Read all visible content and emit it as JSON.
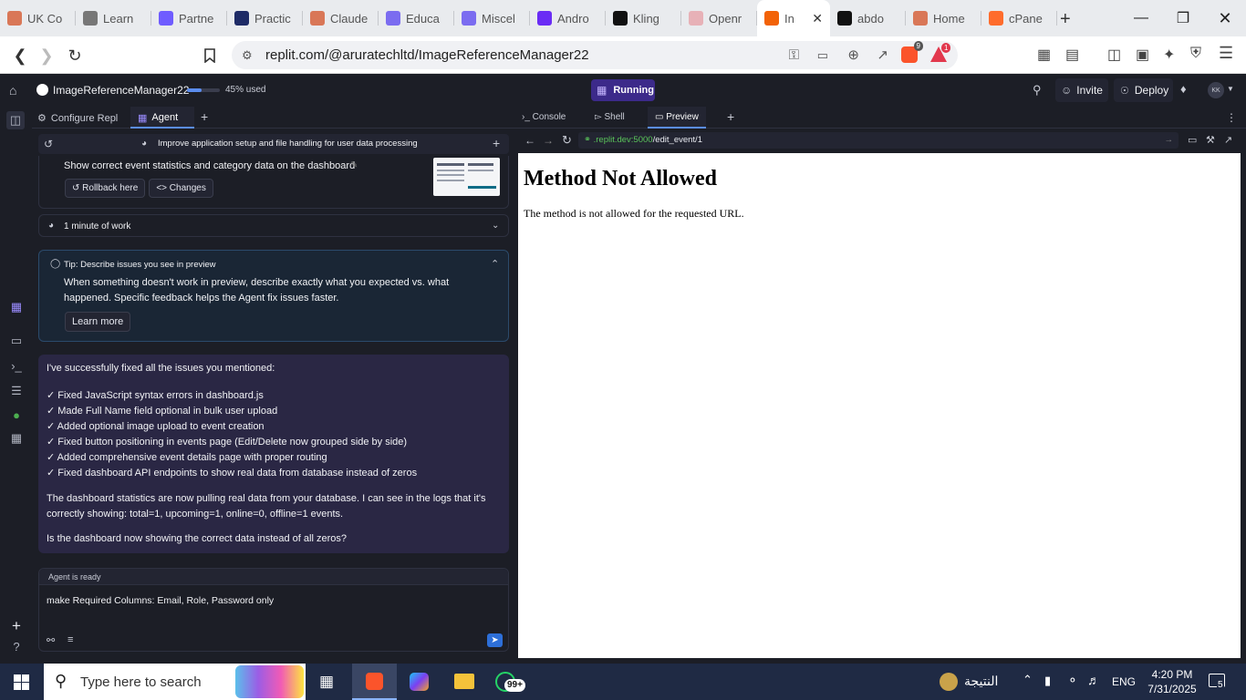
{
  "browser": {
    "tabs": [
      {
        "label": "UK Co",
        "icon": "claude-icon",
        "color": "#d97757"
      },
      {
        "label": "Learn",
        "icon": "tools-icon",
        "color": "#777777"
      },
      {
        "label": "Partne",
        "icon": "purple-app-icon",
        "color": "#6f5cff"
      },
      {
        "label": "Practic",
        "icon": "flag-icon",
        "color": "#1e2b66"
      },
      {
        "label": "Claude",
        "icon": "claude-icon",
        "color": "#d97757"
      },
      {
        "label": "Educa",
        "icon": "play-icon",
        "color": "#7b6cf0"
      },
      {
        "label": "Miscel",
        "icon": "play-icon",
        "color": "#7b6cf0"
      },
      {
        "label": "Andro",
        "icon": "d-icon",
        "color": "#6a2cf5"
      },
      {
        "label": "Kling",
        "icon": "kling-icon",
        "color": "#111111"
      },
      {
        "label": "Openr",
        "icon": "openr-icon",
        "color": "#e7b1b7"
      },
      {
        "label": "In",
        "icon": "replit-icon",
        "color": "#f26207",
        "active": true
      },
      {
        "label": "abdo",
        "icon": "github-icon",
        "color": "#111111"
      },
      {
        "label": "Home",
        "icon": "claude-icon",
        "color": "#d97757"
      },
      {
        "label": "cPane",
        "icon": "cpanel-icon",
        "color": "#ff6c2c"
      }
    ],
    "url": "replit.com/@aruratechltd/ImageReferenceManager22",
    "brave_badge": "9",
    "alert_badge": "1"
  },
  "replit": {
    "project_name": "ImageReferenceManager22",
    "usage_text": "45% used",
    "usage_fraction": 0.45,
    "run_status": "Running",
    "invite_label": "Invite",
    "deploy_label": "Deploy",
    "avatar_initials": "KK",
    "left_tabs": [
      "Configure Repl",
      "Agent"
    ],
    "right_tabs": [
      "Console",
      "Shell",
      "Preview"
    ]
  },
  "agent": {
    "thread_title": "Improve application setup and file handling for user data processing",
    "checkpoint_text": "Show correct event statistics and category data on the dashboard",
    "rollback_label": "Rollback here",
    "changes_label": "Changes",
    "work_duration": "1 minute of work",
    "tip": {
      "title": "Tip: Describe issues you see in preview",
      "body": "When something doesn't work in preview, describe exactly what you expected vs. what happened. Specific feedback helps the Agent fix issues faster.",
      "button": "Learn more"
    },
    "message": {
      "intro": "I've successfully fixed all the issues you mentioned:",
      "items": [
        "✓ Fixed JavaScript syntax errors in dashboard.js",
        "✓ Made Full Name field optional in bulk user upload",
        "✓ Added optional image upload to event creation",
        "✓ Fixed button positioning in events page (Edit/Delete now grouped side by side)",
        "✓ Added comprehensive event details page with proper routing",
        "✓ Fixed dashboard API endpoints to show real data from database instead of zeros"
      ],
      "para": "The dashboard statistics are now pulling real data from your database. I can see in the logs that it's correctly showing: total=1, upcoming=1, online=0, offline=1 events.",
      "question": "Is the dashboard now showing the correct data instead of all zeros?"
    },
    "status": "Agent is ready",
    "input_value": "make Required Columns: Email, Role, Password only"
  },
  "preview": {
    "url_domain": ".replit.dev:5000",
    "url_path": "/edit_event/1",
    "heading": "Method Not Allowed",
    "body": "The method is not allowed for the requested URL."
  },
  "taskbar": {
    "search_placeholder": "Type here to search",
    "whatsapp_badge": "99+",
    "weather_text": "النتيجة",
    "language": "ENG",
    "time": "4:20 PM",
    "date": "7/31/2025",
    "notif_count": "5"
  }
}
